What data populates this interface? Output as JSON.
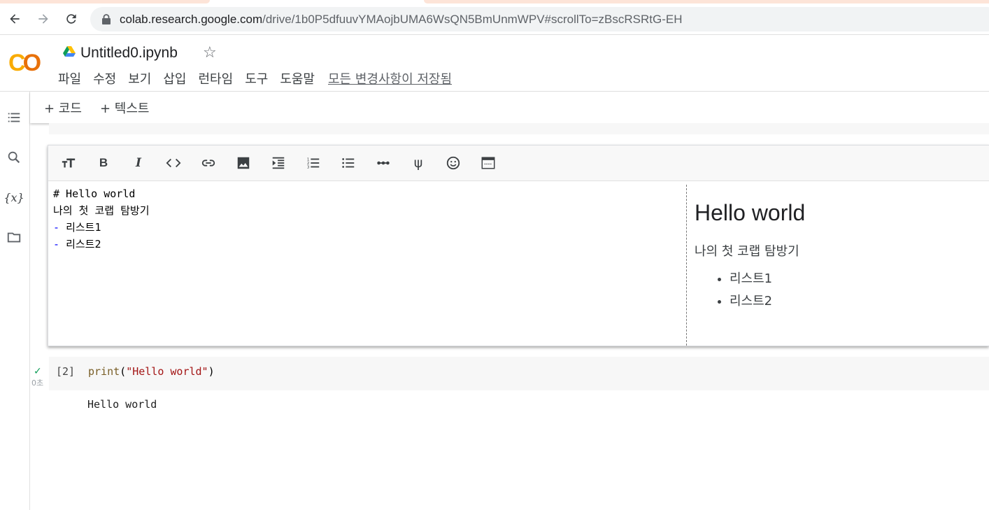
{
  "browser": {
    "url_host": "colab.research.google.com",
    "url_path": "/drive/1b0P5dfuuvYMAojbUMA6WsQN5BmUnmWPV#scrollTo=zBscRSRtG-EH"
  },
  "header": {
    "logo": "CO",
    "notebook_name": "Untitled0.ipynb",
    "menu": [
      "파일",
      "수정",
      "보기",
      "삽입",
      "런타임",
      "도구",
      "도움말"
    ],
    "saved_status": "모든 변경사항이 저장됨"
  },
  "toolbar": {
    "add_code": "+ 코드",
    "add_text": "+ 텍스트"
  },
  "text_cell": {
    "format_icons": [
      "text-size-icon",
      "bold-icon",
      "italic-icon",
      "code-icon",
      "link-icon",
      "image-icon",
      "indent-icon",
      "numbered-list-icon",
      "bulleted-list-icon",
      "horizontal-rule-icon",
      "psi-icon",
      "emoji-icon",
      "preview-icon"
    ],
    "bold_label": "B",
    "italic_label": "I",
    "psi_label": "ψ",
    "source_lines": [
      "# Hello world",
      "나의 첫 코랩 탐방기",
      "- 리스트1",
      "- 리스트2"
    ],
    "preview": {
      "heading": "Hello world",
      "paragraph": "나의 첫 코랩 탐방기",
      "items": [
        "리스트1",
        "리스트2"
      ]
    }
  },
  "code_cell": {
    "run_status": "✓",
    "run_time": "0초",
    "exec_count": "[2]",
    "code_fn": "print",
    "code_open": "(",
    "code_str": "\"Hello world\"",
    "code_close": ")",
    "output": "Hello world"
  },
  "colors": {
    "logo_yellow": "#f9ab00",
    "logo_orange": "#e8710a",
    "markdown_blue": "#0000ff",
    "string_red": "#a31515",
    "success_green": "#0f9d58"
  }
}
